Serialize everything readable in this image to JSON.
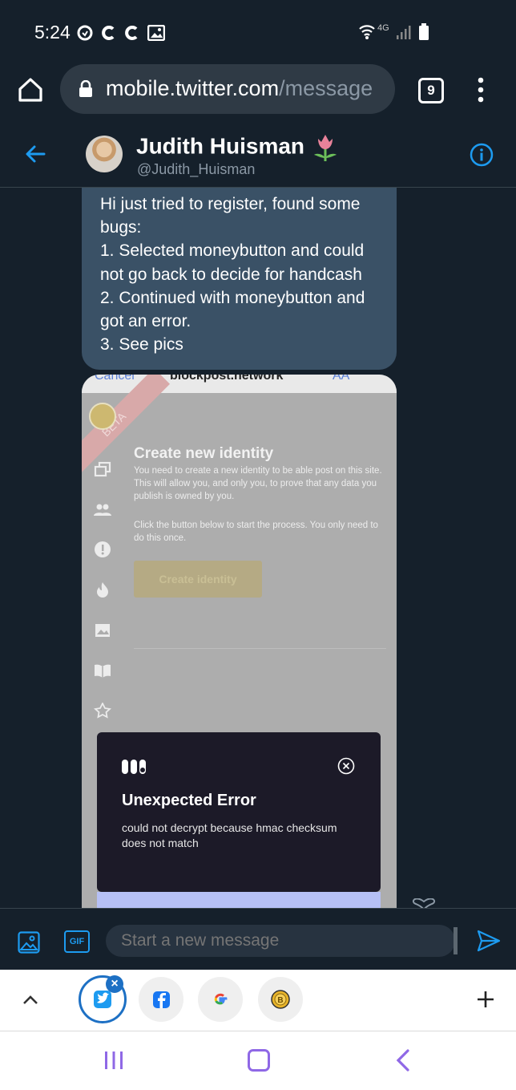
{
  "status_bar": {
    "time": "5:24",
    "left_icons": [
      "chrome-sync-icon",
      "c-icon",
      "c-icon",
      "image-icon"
    ],
    "network": "4G",
    "right_icons": [
      "wifi-icon",
      "signal-icon",
      "battery-icon"
    ]
  },
  "browser": {
    "url_main": "mobile.twitter.com",
    "url_path": "/message",
    "tab_count": "9"
  },
  "conversation_header": {
    "name": "Judith Huisman",
    "handle": "@Judith_Huisman"
  },
  "message": {
    "text": "Hi just tried to register, found some bugs:\n1. Selected moneybutton and could not go back to decide for handcash\n2. Continued with moneybutton and got an error.\n3. See pics"
  },
  "attached_image": {
    "top_bar_left": "Cancel",
    "top_bar_center": "blockpost.network",
    "top_bar_right": "AA",
    "beta_label": "BETA",
    "title": "Create new identity",
    "para1": "You need to create a new identity to be able post on this site. This will allow you, and only you, to prove that any data you publish is owned by you.",
    "para2": "Click the button below to start the process. You only need to do this once.",
    "button_label": "Create identity",
    "error_title": "Unexpected Error",
    "error_message": "could not decrypt because hmac checksum does not match"
  },
  "composer": {
    "placeholder": "Start a new message",
    "gif_label": "GIF"
  },
  "shortcuts": [
    "twitter",
    "facebook",
    "google",
    "bitcoin"
  ],
  "colors": {
    "background": "#15202b",
    "accent": "#1d9bf0",
    "bubble": "#3a5166",
    "nav_purple": "#8f68e6"
  }
}
